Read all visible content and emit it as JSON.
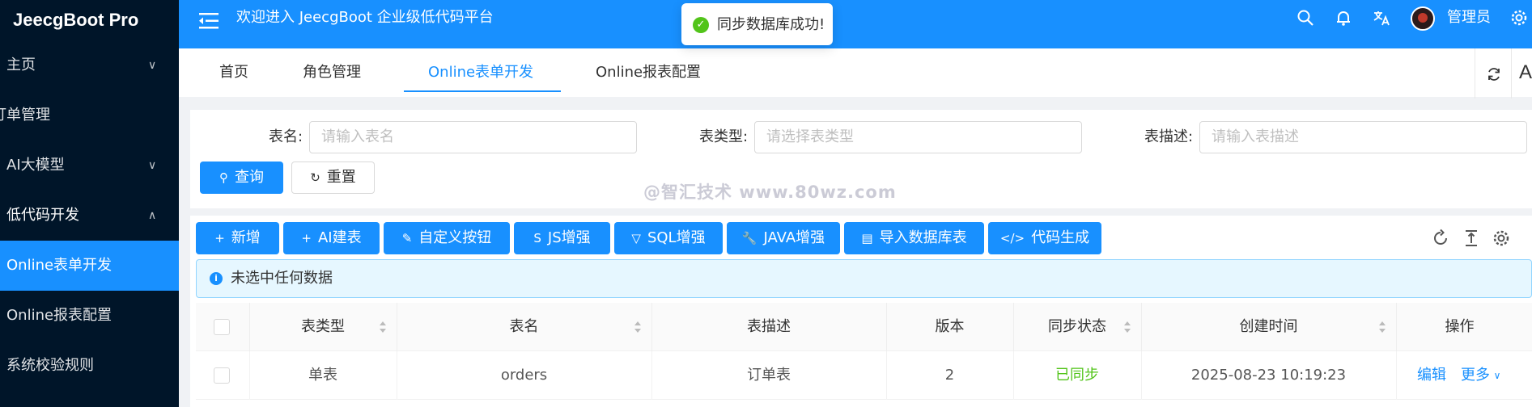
{
  "sidebar": {
    "logo": "JeecgBoot Pro",
    "items": [
      {
        "label": "主页",
        "chevron": "∨"
      },
      {
        "label": "订单管理"
      },
      {
        "label": "AI大模型",
        "chevron": "∨"
      },
      {
        "label": "低代码开发",
        "chevron": "∧"
      },
      {
        "label": "Online表单开发"
      },
      {
        "label": "Online报表配置"
      },
      {
        "label": "系统校验规则"
      }
    ]
  },
  "header": {
    "title": "欢迎进入 JeecgBoot 企业级低代码平台",
    "user": "管理员"
  },
  "toast": {
    "text": "同步数据库成功!"
  },
  "tabs": [
    "首页",
    "角色管理",
    "Online表单开发",
    "Online报表配置"
  ],
  "tabs_right_letter": "A",
  "search": {
    "fields": [
      {
        "label": "表名:",
        "placeholder": "请输入表名"
      },
      {
        "label": "表类型:",
        "placeholder": "请选择表类型"
      },
      {
        "label": "表描述:",
        "placeholder": "请输入表描述"
      }
    ],
    "query_button": "查询",
    "reset_button": "重置"
  },
  "toolbar": {
    "buttons": [
      {
        "icon": "+",
        "label": "新增"
      },
      {
        "icon": "+",
        "label": "AI建表"
      },
      {
        "icon": "✎",
        "label": "自定义按钮"
      },
      {
        "icon": "S",
        "label": "JS增强"
      },
      {
        "icon": "▽",
        "label": "SQL增强"
      },
      {
        "icon": "🔧",
        "label": "JAVA增强"
      },
      {
        "icon": "▤",
        "label": "导入数据库表"
      },
      {
        "icon": "</>",
        "label": "代码生成"
      }
    ]
  },
  "alert": {
    "text": "未选中任何数据"
  },
  "table": {
    "columns": [
      "表类型",
      "表名",
      "表描述",
      "版本",
      "同步状态",
      "创建时间",
      "操作"
    ],
    "rows": [
      {
        "type": "单表",
        "name": "orders",
        "desc": "订单表",
        "version": "2",
        "sync": "已同步",
        "created": "2025-08-23 10:19:23",
        "edit": "编辑",
        "more": "更多"
      }
    ]
  },
  "watermark": "@智汇技术 www.80wz.com",
  "colors": {
    "primary": "#1890ff",
    "sidebar": "#001529",
    "success": "#52c41a"
  }
}
